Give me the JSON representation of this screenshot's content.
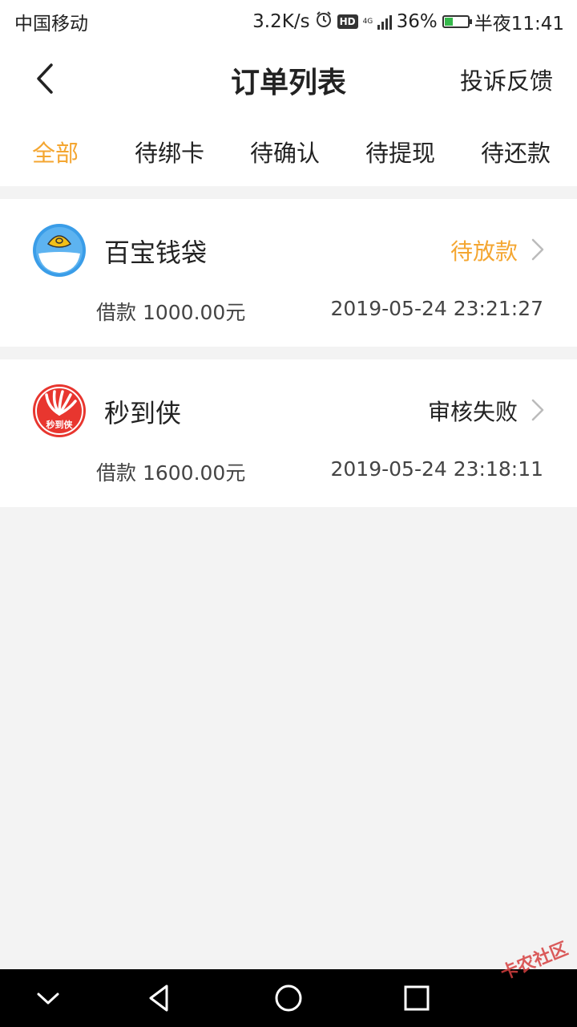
{
  "status_bar": {
    "carrier": "中国移动",
    "speed": "3.2K/s",
    "hd": "HD",
    "network": "4G",
    "battery": "36%",
    "battery_level": 0.36,
    "time": "半夜11:41"
  },
  "header": {
    "title": "订单列表",
    "complaint_label": "投诉反馈"
  },
  "tabs": [
    {
      "label": "全部",
      "active": true
    },
    {
      "label": "待绑卡",
      "active": false
    },
    {
      "label": "待确认",
      "active": false
    },
    {
      "label": "待提现",
      "active": false
    },
    {
      "label": "待还款",
      "active": false
    }
  ],
  "orders": [
    {
      "merchant": "百宝钱袋",
      "status": "待放款",
      "amount": "借款 1000.00元",
      "time": "2019-05-24 23:21:27",
      "icon": "money-bag-icon",
      "status_color": "#f4a631"
    },
    {
      "merchant": "秒到侠",
      "status": "审核失败",
      "amount": "借款 1600.00元",
      "time": "2019-05-24 23:18:11",
      "icon": "miaodaoxia-logo",
      "logo_text": "秒到侠",
      "status_color": "#222222"
    }
  ],
  "watermark": "卡农社区",
  "colors": {
    "accent": "#f4a631",
    "background": "#f3f3f3"
  }
}
